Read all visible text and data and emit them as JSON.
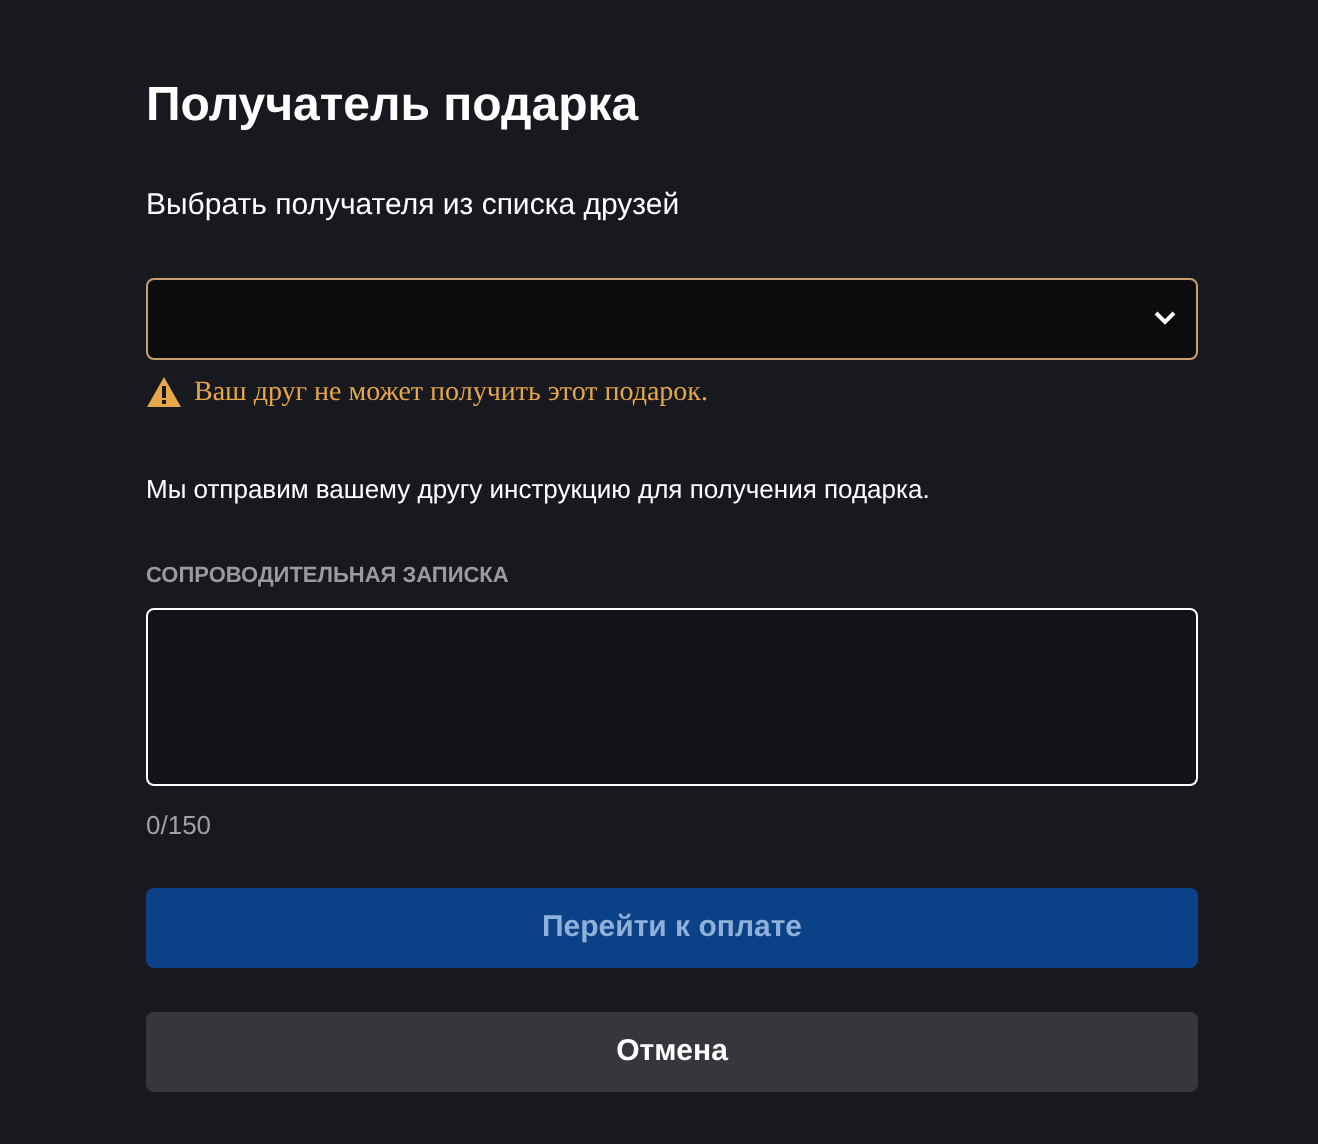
{
  "title": "Получатель подарка",
  "recipient": {
    "label": "Выбрать получателя из списка друзей",
    "warning": "Ваш друг не может получить этот подарок.",
    "invalid": true
  },
  "info": "Мы отправим вашему другу инструкцию для получения подарка.",
  "note": {
    "label": "СОПРОВОДИТЕЛЬНАЯ ЗАПИСКА",
    "focused": true,
    "counter": "0/150"
  },
  "buttons": [
    {
      "label": "Перейти к оплате",
      "kind": "primary",
      "disabled": true
    },
    {
      "label": "Отмена",
      "kind": "secondary",
      "disabled": false
    }
  ]
}
